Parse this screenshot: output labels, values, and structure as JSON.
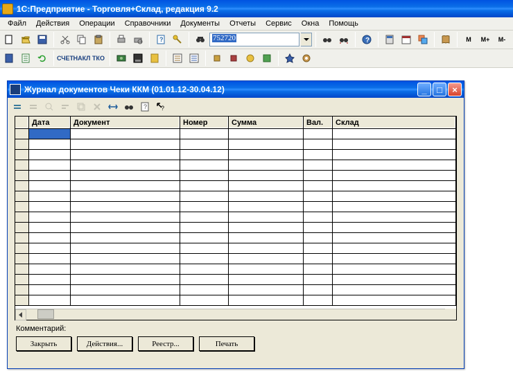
{
  "app": {
    "title": "1С:Предприятие - Торговля+Склад, редакция 9.2"
  },
  "menu": {
    "file": "Файл",
    "actions": "Действия",
    "operations": "Операции",
    "directories": "Справочники",
    "documents": "Документы",
    "reports": "Отчеты",
    "service": "Сервис",
    "windows": "Окна",
    "help": "Помощь"
  },
  "toolbar1": {
    "search_value": "752720",
    "m": "М",
    "mplus": "М+",
    "mminus": "М-"
  },
  "toolbar2": {
    "schet": "СЧЕТ",
    "nakl": "НАКЛ",
    "tko": "ТКО"
  },
  "child": {
    "title": "Журнал документов  Чеки ККМ (01.01.12-30.04.12)",
    "columns": {
      "date": "Дата",
      "document": "Документ",
      "number": "Номер",
      "sum": "Сумма",
      "currency": "Вал.",
      "warehouse": "Склад"
    },
    "comment_label": "Комментарий:",
    "buttons": {
      "close": "Закрыть",
      "actions": "Действия...",
      "registry": "Реестр...",
      "print": "Печать"
    }
  }
}
